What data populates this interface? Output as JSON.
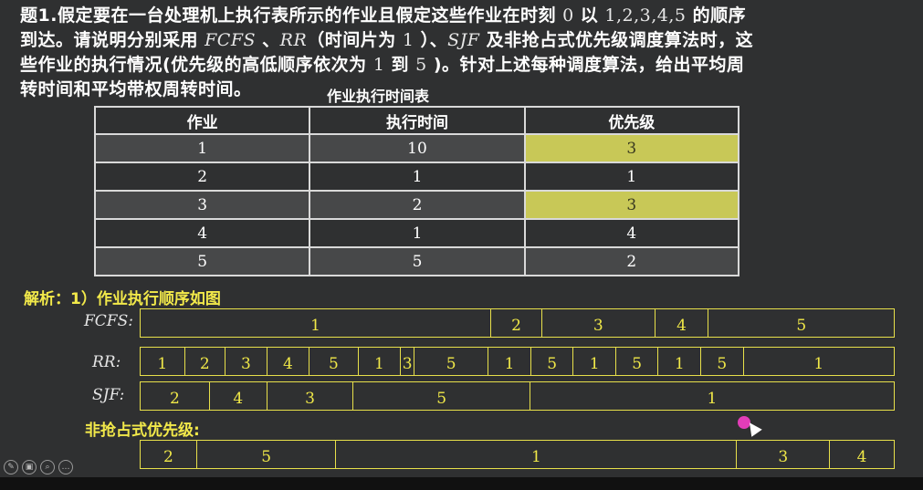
{
  "question": {
    "lines": [
      {
        "parts": [
          {
            "t": "题1.假定要在一台处理机上执行表所示的作业且假定这些作业在时刻 ",
            "c": "b"
          },
          {
            "t": "0",
            "c": "num"
          },
          {
            "t": " 以 ",
            "c": "b"
          },
          {
            "t": "1,2,3,4,5",
            "c": "num"
          },
          {
            "t": " 的顺序",
            "c": "b"
          }
        ]
      },
      {
        "parts": [
          {
            "t": "到达。请说明分别采用 ",
            "c": "b"
          },
          {
            "t": "FCFS",
            "c": "it"
          },
          {
            "t": " 、",
            "c": "b"
          },
          {
            "t": "RR",
            "c": "it"
          },
          {
            "t": "（时间片为 ",
            "c": "b"
          },
          {
            "t": "1",
            "c": "num"
          },
          {
            "t": " ）、",
            "c": "b"
          },
          {
            "t": "SJF",
            "c": "it"
          },
          {
            "t": " 及非抢占式优先级调度算法时，这",
            "c": "b"
          }
        ]
      },
      {
        "parts": [
          {
            "t": "些作业的执行情况(优先级的高低顺序依次为 ",
            "c": "b"
          },
          {
            "t": "1",
            "c": "num"
          },
          {
            "t": " 到 ",
            "c": "b"
          },
          {
            "t": "5",
            "c": "num"
          },
          {
            "t": " )。针对上述每种调度算法，给出平均周",
            "c": "b"
          }
        ]
      },
      {
        "parts": [
          {
            "t": "转时间和平均带权周转时间。",
            "c": "b"
          }
        ]
      }
    ]
  },
  "table": {
    "caption": "作业执行时间表",
    "headers": [
      "作业",
      "执行时间",
      "优先级"
    ],
    "rows": [
      [
        "1",
        "10",
        "3"
      ],
      [
        "2",
        "1",
        "1"
      ],
      [
        "3",
        "2",
        "3"
      ],
      [
        "4",
        "1",
        "4"
      ],
      [
        "5",
        "5",
        "2"
      ]
    ]
  },
  "analysis": {
    "title": "解析：1）作业执行顺序如图",
    "fcfs": {
      "label": "FCFS:",
      "segments": [
        "1",
        "2",
        "3",
        "4",
        "5"
      ]
    },
    "rr": {
      "label": "RR:",
      "segments": [
        "1",
        "2",
        "3",
        "4",
        "5",
        "1",
        "3",
        "5",
        "1",
        "5",
        "1",
        "5",
        "1",
        "5",
        "1"
      ]
    },
    "sjf": {
      "label": "SJF:",
      "segments": [
        "2",
        "4",
        "3",
        "5",
        "1"
      ]
    },
    "np": {
      "label": "非抢占式优先级:",
      "segments": [
        "2",
        "5",
        "1",
        "3",
        "4"
      ]
    }
  },
  "colors": {
    "accent": "#f2e94a",
    "highlight": "#c8c857"
  },
  "toolbar": {
    "icons": [
      "pen-icon",
      "copy-icon",
      "zoom-icon",
      "more-icon"
    ]
  }
}
